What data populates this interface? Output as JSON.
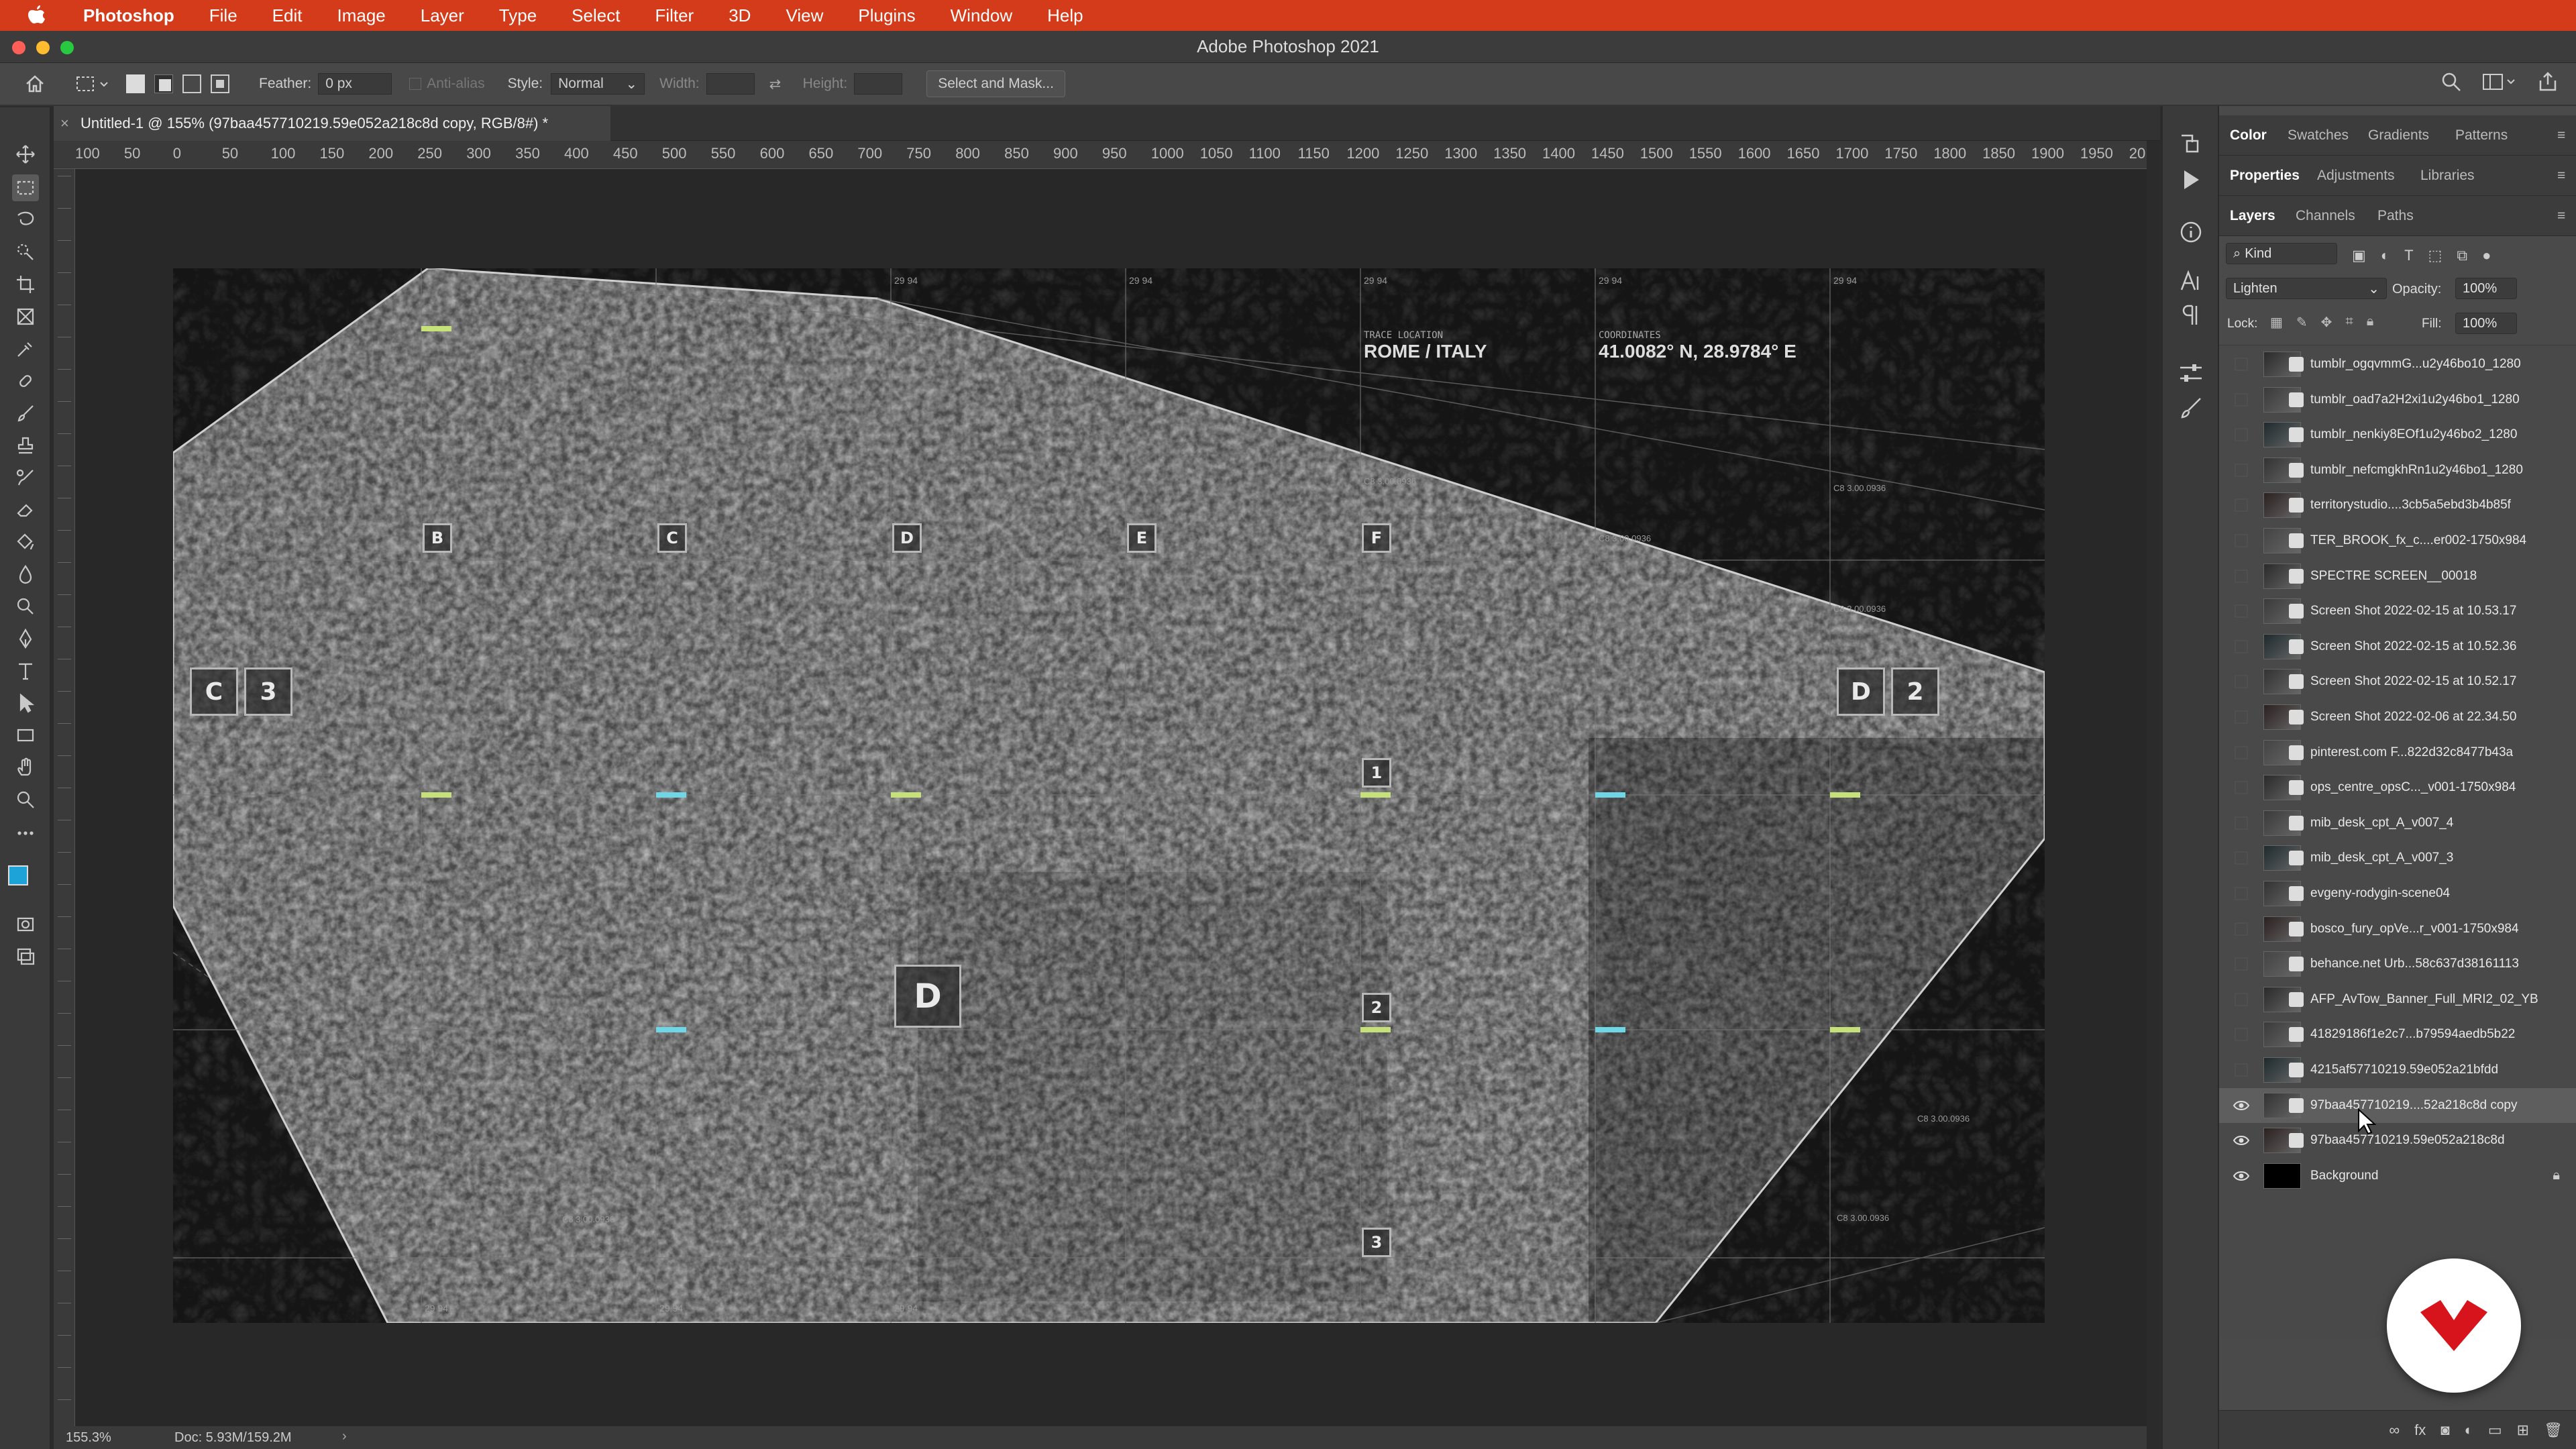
{
  "menubar": {
    "app": "Photoshop",
    "items": [
      "File",
      "Edit",
      "Image",
      "Layer",
      "Type",
      "Select",
      "Filter",
      "3D",
      "View",
      "Plugins",
      "Window",
      "Help"
    ]
  },
  "window": {
    "title": "Adobe Photoshop 2021"
  },
  "options": {
    "feather_label": "Feather:",
    "feather_value": "0 px",
    "antialias": "Anti-alias",
    "style_label": "Style:",
    "style_value": "Normal",
    "width_label": "Width:",
    "height_label": "Height:",
    "select_mask": "Select and Mask..."
  },
  "document": {
    "tab_title": "Untitled-1 @ 155% (97baa457710219.59e052a218c8d copy, RGB/8#) *"
  },
  "ruler": {
    "h": [
      "100",
      "50",
      "0",
      "50",
      "100",
      "150",
      "200",
      "250",
      "300",
      "350",
      "400",
      "450",
      "500",
      "550",
      "600",
      "650",
      "700",
      "750",
      "800",
      "850",
      "900",
      "950",
      "1000",
      "1050",
      "1100",
      "1150",
      "1200",
      "1250",
      "1300",
      "1350",
      "1400",
      "1450",
      "1500",
      "1550",
      "1600",
      "1650",
      "1700",
      "1750",
      "1800",
      "1850",
      "1900",
      "1950",
      "20"
    ]
  },
  "status": {
    "zoom": "155.3%",
    "doc": "Doc: 5.93M/159.2M"
  },
  "artwork": {
    "trace_label": "TRACE LOCATION",
    "trace_value": "ROME / ITALY",
    "coord_label": "COORDINATES",
    "coord_value": "41.0082° N, 28.9784° E",
    "cols": [
      "B",
      "C",
      "D",
      "E",
      "F"
    ],
    "left_tag": [
      "C",
      "3"
    ],
    "right_tag": [
      "D",
      "2"
    ],
    "big_d": "D",
    "nums": [
      "1",
      "2",
      "3"
    ],
    "small": "29 94",
    "code": "C8 3.00.0936"
  },
  "panels": {
    "top_tabs": [
      "Color",
      "Swatches",
      "Gradients",
      "Patterns"
    ],
    "mid_tabs": [
      "Properties",
      "Adjustments",
      "Libraries"
    ],
    "layer_tabs": [
      "Layers",
      "Channels",
      "Paths"
    ],
    "kind": "Kind",
    "blend": "Lighten",
    "opacity_label": "Opacity:",
    "opacity": "100%",
    "lock_label": "Lock:",
    "fill_label": "Fill:",
    "fill": "100%",
    "layers": [
      "tumblr_ogqvmmG...u2y46bo10_1280",
      "tumblr_oad7a2H2xi1u2y46bo1_1280",
      "tumblr_nenkiy8EOf1u2y46bo2_1280",
      "tumblr_nefcmgkhRn1u2y46bo1_1280",
      "territorystudio....3cb5a5ebd3b4b85f",
      "TER_BROOK_fx_c....er002-1750x984",
      "SPECTRE SCREEN__00018",
      "Screen Shot 2022-02-15 at 10.53.17",
      "Screen Shot 2022-02-15 at 10.52.36",
      "Screen Shot 2022-02-15 at 10.52.17",
      "Screen Shot 2022-02-06 at 22.34.50",
      "pinterest.com F...822d32c8477b43a",
      "ops_centre_opsC..._v001-1750x984",
      "mib_desk_cpt_A_v007_4",
      "mib_desk_cpt_A_v007_3",
      "evgeny-rodygin-scene04",
      "bosco_fury_opVe...r_v001-1750x984",
      "behance.net Urb...58c637d38161113",
      "AFP_AvTow_Banner_Full_MRI2_02_YB",
      "41829186f1e2c7...b79594aedb5b22",
      "4215af57710219.59e052a21bfdd",
      "97baa457710219....52a218c8d copy",
      "97baa457710219.59e052a218c8d",
      "Background"
    ]
  },
  "colors": {
    "menubar": "#d33b1a",
    "fg": "#1ea3d8",
    "accent_lime": "#c6e07a",
    "accent_cyan": "#6fd6e6"
  }
}
